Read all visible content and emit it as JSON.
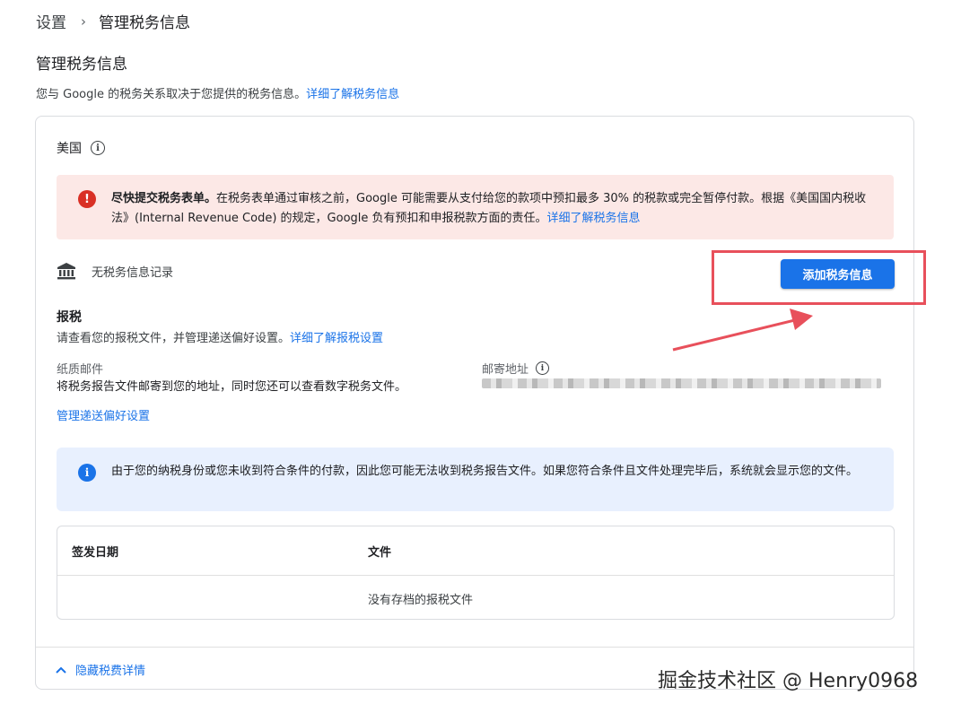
{
  "breadcrumb": {
    "parent": "设置",
    "separator": "›",
    "current": "管理税务信息"
  },
  "page": {
    "title": "管理税务信息",
    "intro_text": "您与 Google 的税务关系取决于您提供的税务信息。",
    "intro_link": "详细了解税务信息"
  },
  "country": {
    "name": "美国",
    "info_icon": "info-outline-icon"
  },
  "error_alert": {
    "icon": "error-icon",
    "bold": "尽快提交税务表单。",
    "text": "在税务表单通过审核之前，Google 可能需要从支付给您的款项中预扣最多 30% 的税款或完全暂停付款。根据《美国国内税收法》(Internal Revenue Code) 的规定，Google 负有预扣和申报税款方面的责任。",
    "link": "详细了解税务信息",
    "color": "#fce8e6"
  },
  "tax_info": {
    "icon": "bank-icon",
    "empty_text": "无税务信息记录",
    "add_button": "添加税务信息"
  },
  "tax_reporting": {
    "title": "报税",
    "desc": "请查看您的报税文件，并管理递送偏好设置。",
    "desc_link": "详细了解报税设置",
    "paper_label": "纸质邮件",
    "paper_desc": "将税务报告文件邮寄到您的地址，同时您还可以查看数字税务文件。",
    "mail_label": "邮寄地址",
    "manage_link": "管理递送偏好设置"
  },
  "info_alert": {
    "icon": "info-icon",
    "text": "由于您的纳税身份或您未收到符合条件的付款，因此您可能无法收到税务报告文件。如果您符合条件且文件处理完毕后，系统就会显示您的文件。",
    "color": "#e8f0fe"
  },
  "documents_table": {
    "columns": [
      "签发日期",
      "文件"
    ],
    "empty_text": "没有存档的报税文件"
  },
  "footer": {
    "hide_link": "隐藏税费详情",
    "icon": "chevron-up-icon"
  },
  "watermark": "掘金技术社区 @ Henry0968",
  "colors": {
    "accent": "#1a73e8",
    "error": "#d93025",
    "annotation": "#e8505b"
  }
}
